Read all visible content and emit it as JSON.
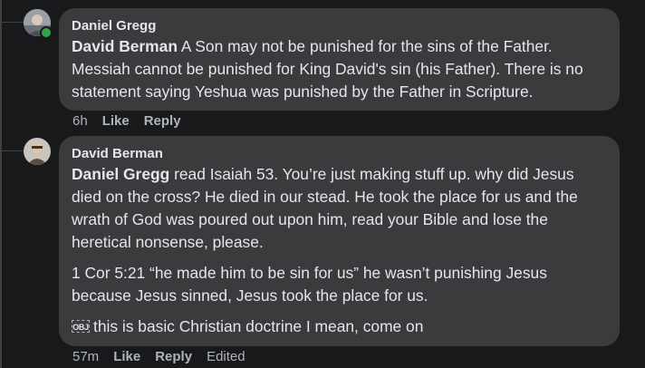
{
  "comments": [
    {
      "author": "Daniel Gregg",
      "mention": "David Berman",
      "body": " A Son may not be punished for the sins of the Father. Messiah cannot be punished for King David's sin (his Father). There is no statement saying Yeshua was punished by the Father in Scripture.",
      "time": "6h",
      "like_label": "Like",
      "reply_label": "Reply",
      "online": true
    },
    {
      "author": "David Berman",
      "mention": "Daniel Gregg",
      "body": " read Isaiah 53. You’re just making stuff up. why did Jesus died on the cross? He died in our stead. He took the place for us and the wrath of God was poured out upon him, read your Bible and lose the heretical nonsense, please.",
      "paragraph2": "1 Cor 5:21 “he made him to be sin for us” he wasn’t punishing Jesus because Jesus sinned, Jesus took the place for us.",
      "obj_icon": "OBJ",
      "paragraph3": "this is basic Christian doctrine I mean, come on",
      "time": "57m",
      "like_label": "Like",
      "reply_label": "Reply",
      "edited_label": "Edited"
    }
  ],
  "colors": {
    "background": "#18191a",
    "bubble": "#3a3b3c",
    "text": "#e4e6eb",
    "secondary_text": "#b0b3b8",
    "online": "#31a24c"
  }
}
